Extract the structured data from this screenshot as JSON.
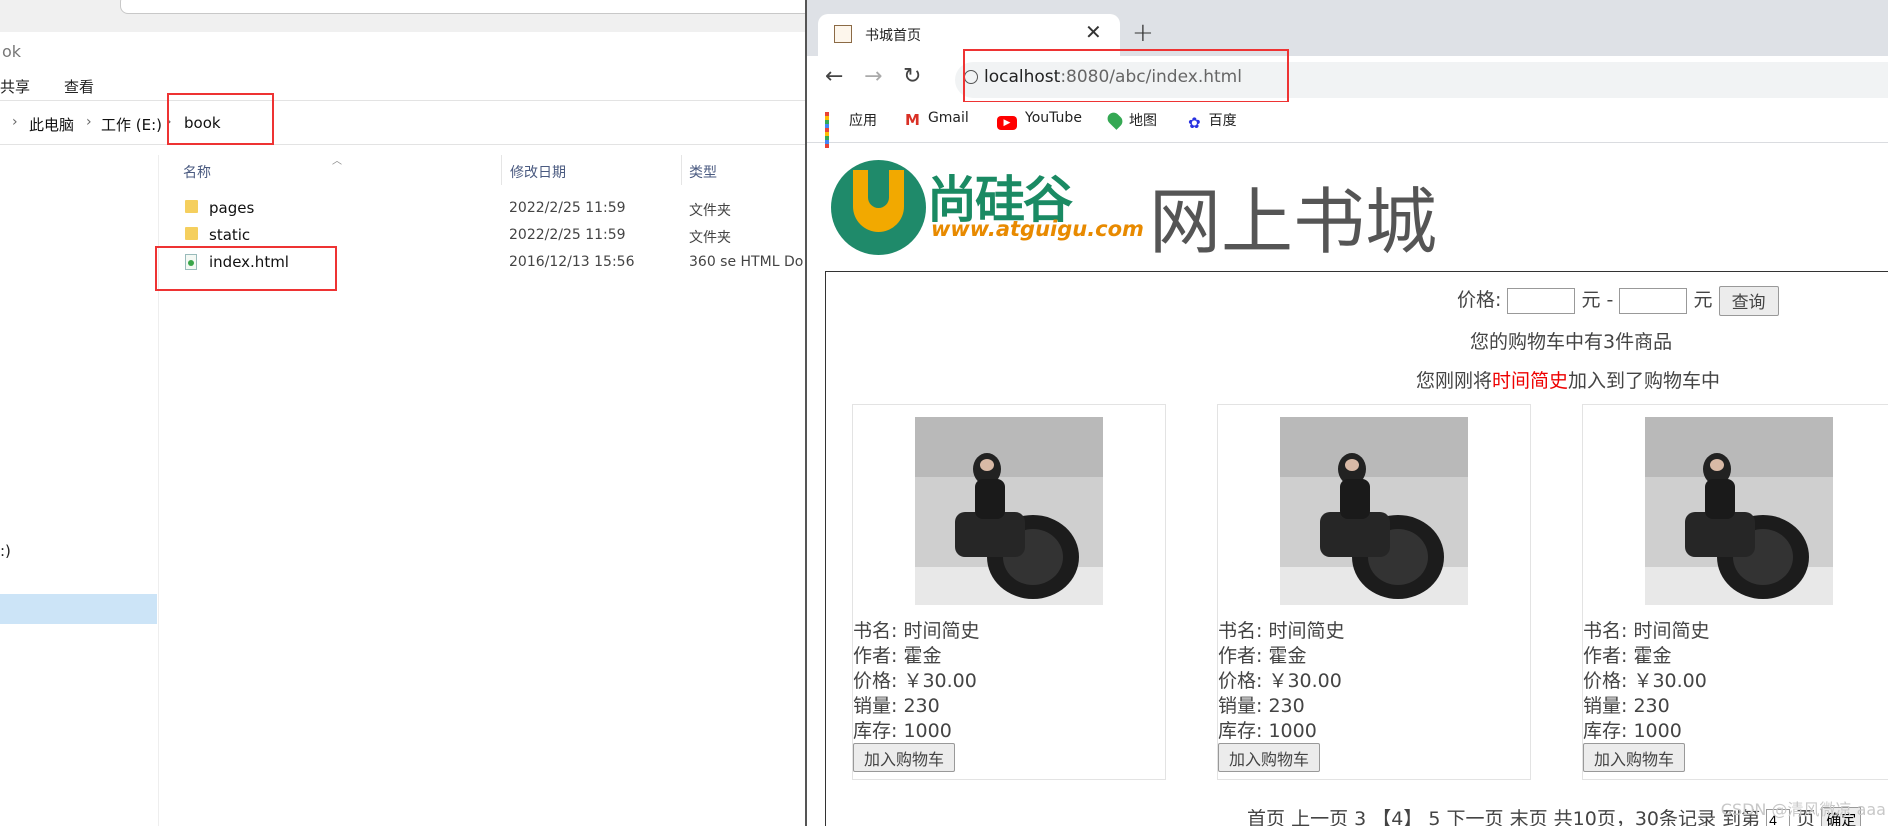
{
  "explorer": {
    "title_fragment": "ok",
    "ribbon": [
      "共享",
      "查看"
    ],
    "breadcrumb": [
      "此电脑",
      "工作 (E:)",
      "book"
    ],
    "columns": [
      "名称",
      "修改日期",
      "类型"
    ],
    "files": [
      {
        "name": "pages",
        "date": "2022/2/25 11:59",
        "type": "文件夹",
        "icon": "folder-icon"
      },
      {
        "name": "static",
        "date": "2022/2/25 11:59",
        "type": "文件夹",
        "icon": "folder-icon"
      },
      {
        "name": "index.html",
        "date": "2016/12/13 15:56",
        "type": "360 se HTML Do",
        "icon": "html-file-icon"
      }
    ],
    "nav_fragment": ":)"
  },
  "browser": {
    "tab_title": "书城首页",
    "url_host": "localhost",
    "url_rest": ":8080/abc/index.html",
    "bookmarks": [
      "应用",
      "Gmail",
      "YouTube",
      "地图",
      "百度"
    ]
  },
  "page": {
    "logo_cn": "尚硅谷",
    "logo_url": "www.atguigu.com",
    "site_title": "网上书城",
    "search": {
      "label": "价格:",
      "unit1": "元 -",
      "unit2": "元",
      "button": "查询"
    },
    "cart_count": "您的购物车中有3件商品",
    "cart_msg_prefix": "您刚刚将",
    "cart_msg_book": "时间简史",
    "cart_msg_suffix": "加入到了购物车中",
    "books": [
      {
        "name": "书名: 时间简史",
        "author": "作者: 霍金",
        "price": "价格: ￥30.00",
        "sales": "销量: 230",
        "stock": "库存: 1000",
        "button": "加入购物车"
      },
      {
        "name": "书名: 时间简史",
        "author": "作者: 霍金",
        "price": "价格: ￥30.00",
        "sales": "销量: 230",
        "stock": "库存: 1000",
        "button": "加入购物车"
      },
      {
        "name": "书名: 时间简史",
        "author": "作者: 霍金",
        "price": "价格: ￥30.00",
        "sales": "销量: 230",
        "stock": "库存: 1000",
        "button": "加入购物车"
      }
    ],
    "pager": {
      "first": "首页",
      "prev": "上一页",
      "p3": "3",
      "current": "【4】",
      "p5": "5",
      "next": "下一页",
      "last": "末页",
      "total": "共10页，30条记录 到第",
      "page_input": "4",
      "page_unit": "页",
      "confirm": "确定"
    },
    "watermark": "CSDN @清风微凉 aaa"
  }
}
